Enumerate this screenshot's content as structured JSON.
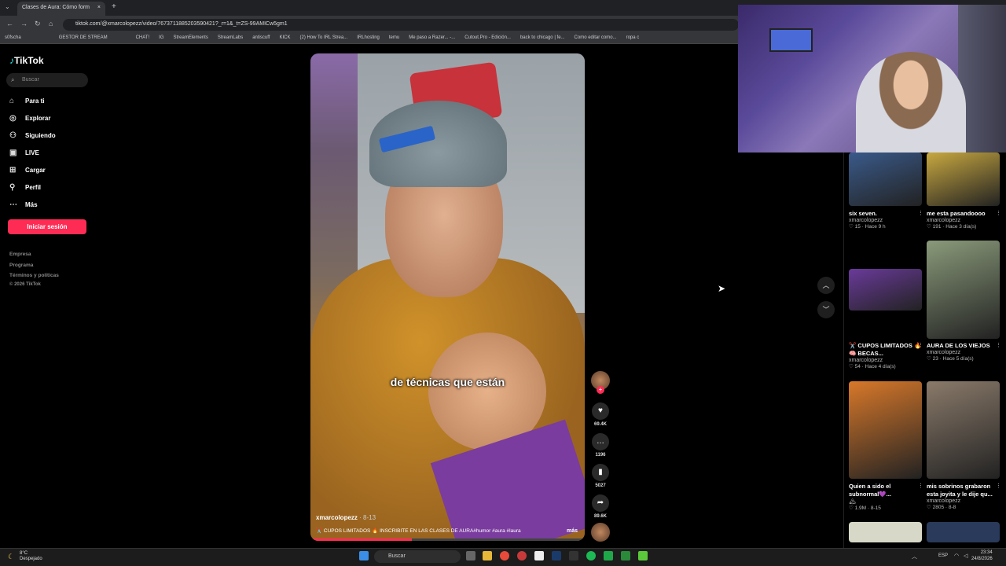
{
  "browser": {
    "tab_title": "Clases de Aura: Cómo form",
    "url": "tiktok.com/@xmarcolopezz/video/7673711885203590421?_r=1&_t=ZS-99AMICw5gm1",
    "bookmarks": [
      "s0fscha",
      "",
      "",
      "",
      "GESTOR DE STREAM",
      "",
      "",
      "CHAT!",
      "IG",
      "StreamElements",
      "StreamLabs",
      "antiscuff",
      "KICK",
      "(2) How To IRL Strea...",
      "IRLhosting",
      "temu",
      "Me paso a Razer... -...",
      "Cutout.Pro - Edición...",
      "back to chicago | fe...",
      "Como editar como...",
      "ropa c"
    ]
  },
  "sidebar": {
    "logo": "TikTok",
    "search_placeholder": "Buscar",
    "items": [
      {
        "label": "Para ti",
        "icon": "home-icon"
      },
      {
        "label": "Explorar",
        "icon": "compass-icon"
      },
      {
        "label": "Siguiendo",
        "icon": "following-icon"
      },
      {
        "label": "LIVE",
        "icon": "live-icon"
      },
      {
        "label": "Cargar",
        "icon": "upload-icon"
      },
      {
        "label": "Perfil",
        "icon": "profile-icon"
      },
      {
        "label": "Más",
        "icon": "more-icon"
      }
    ],
    "login_button": "Iniciar sesión",
    "footer": [
      "Empresa",
      "Programa",
      "Términos y políticas",
      "© 2026 TikTok"
    ]
  },
  "video": {
    "caption": "de técnicas que están",
    "username": "xmarcolopezz",
    "date": " · 8-13",
    "description": "✂️ CUPOS LIMITADOS 🔥 INSCRIBITE EN LAS CLASES DE AURA#humor #aura #laura",
    "more": "más",
    "progress": 0.37,
    "likes": "69.4K",
    "comments": "1196",
    "saves": "5027",
    "shares": "89.6K"
  },
  "recommended": [
    {
      "title": "six seven.",
      "user": "xmarcolopezz",
      "meta": "♡ 15 · Hace 9 h",
      "color": "#3a5a8a"
    },
    {
      "title": "me esta pasandoooo",
      "user": "xmarcolopezz",
      "meta": "♡ 191 · Hace 3 día(s)",
      "color": "#c8a840"
    },
    {
      "title": "✂️ CUPOS LIMITADOS 🔥 🧠 BECAS...",
      "user": "xmarcolopezz",
      "meta": "♡ 54 · Hace 4 día(s)",
      "color": "#6a3a9a"
    },
    {
      "title": "AURA DE LOS VIEJOS",
      "user": "xmarcolopezz",
      "meta": "♡ 23 · Hace 5 día(s)",
      "color": "#8a9a7a"
    },
    {
      "title": "Quien a sido el subnormal💜...",
      "user": "🏔",
      "meta": "♡ 1.9M · 8-15",
      "color": "#d8782a"
    },
    {
      "title": "mis sobrinos grabaron esta joyita y le dije qu...",
      "user": "xmarcolopezz",
      "meta": "♡ 2805 · 8-8",
      "color": "#8a7a6a"
    }
  ],
  "taskbar": {
    "weather_temp": "8°C",
    "weather_desc": "Despejado",
    "search": "Buscar",
    "lang": "ESP",
    "time": "23:34",
    "date": "24/8/2026"
  },
  "colors": {
    "accent": "#fe2c55",
    "background": "#000000"
  }
}
